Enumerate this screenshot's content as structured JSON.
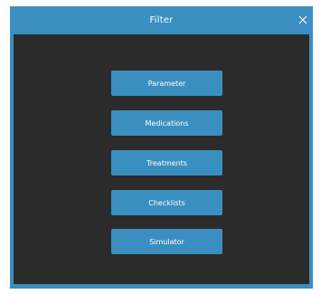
{
  "window": {
    "title": "Filter",
    "close_icon": "close-icon",
    "accent_color": "#3a8fc0",
    "content_bg": "#2b2b2b"
  },
  "menu": {
    "buttons": [
      {
        "label": "Parameter"
      },
      {
        "label": "Medications"
      },
      {
        "label": "Treatments"
      },
      {
        "label": "Checklists"
      },
      {
        "label": "Simulator"
      }
    ]
  }
}
